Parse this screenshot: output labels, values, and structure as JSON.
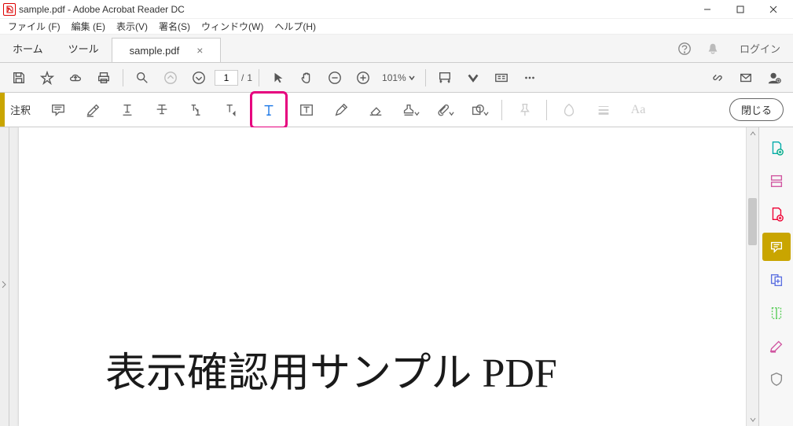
{
  "window": {
    "title": "sample.pdf - Adobe Acrobat Reader DC"
  },
  "menu": {
    "file": "ファイル (F)",
    "edit": "編集 (E)",
    "view": "表示(V)",
    "sign": "署名(S)",
    "window": "ウィンドウ(W)",
    "help": "ヘルプ(H)"
  },
  "tabs": {
    "home": "ホーム",
    "tools": "ツール",
    "doc": "sample.pdf",
    "login": "ログイン"
  },
  "toolbar": {
    "page_current": "1",
    "page_sep": "/",
    "page_total": "1",
    "zoom": "101%"
  },
  "commentbar": {
    "label": "注釈",
    "close": "閉じる",
    "text_color": "Aa"
  },
  "document": {
    "heading": "表示確認用サンプル PDF"
  }
}
